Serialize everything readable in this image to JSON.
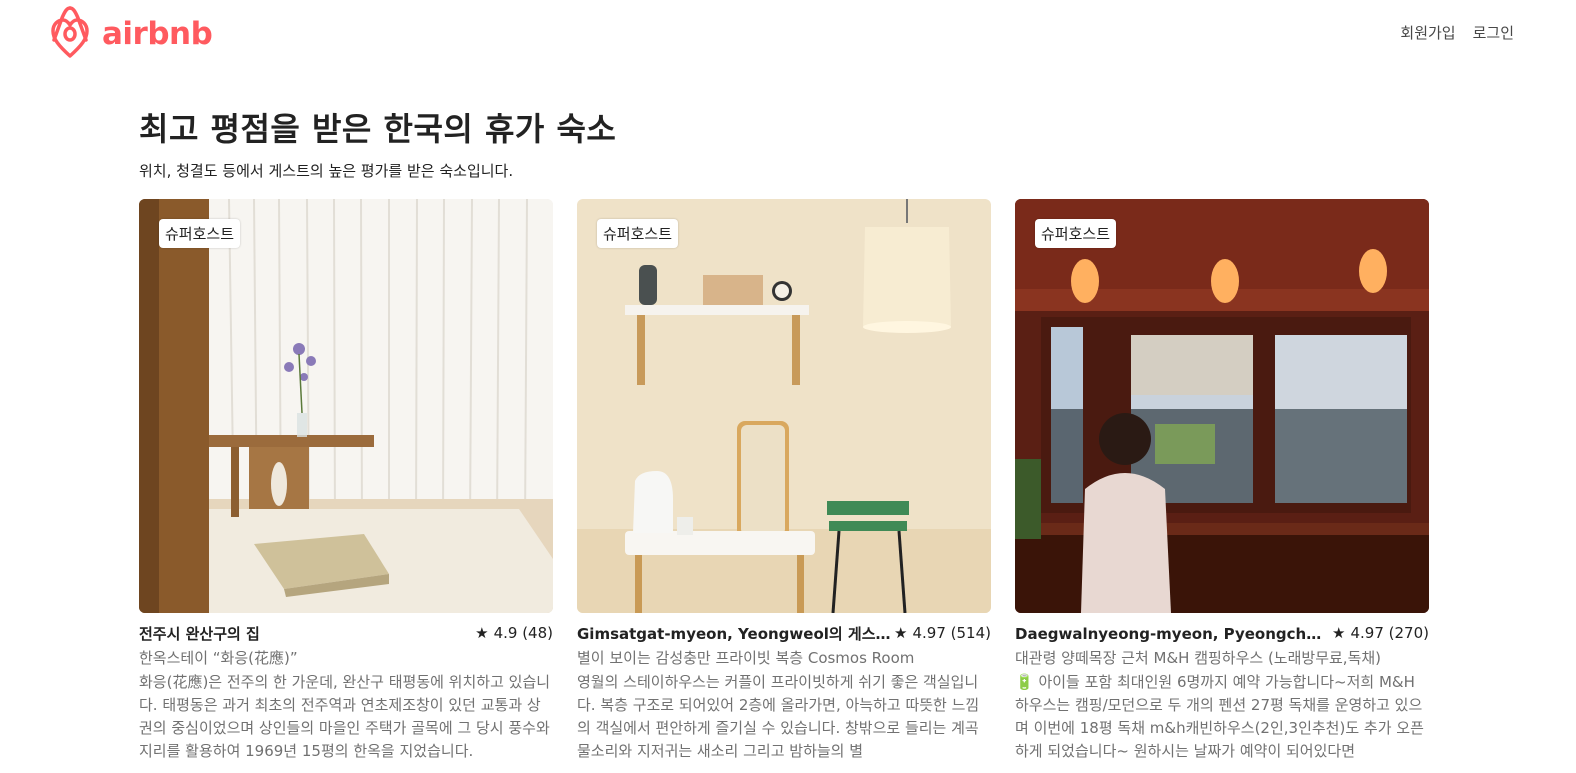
{
  "brand": {
    "name": "airbnb",
    "color": "#ff5a5f",
    "icon": "airbnb-belo-icon"
  },
  "nav": {
    "signup": "회원가입",
    "login": "로그인"
  },
  "section": {
    "title": "최고 평점을 받은 한국의 휴가 숙소",
    "subtitle": "위치, 청결도 등에서 게스트의 높은 평가를 받은 숙소입니다."
  },
  "listings": [
    {
      "badge": "슈퍼호스트",
      "title": "전주시 완산구의 집",
      "rating": "4.9",
      "reviews": "(48)",
      "subtitle": "한옥스테이 “화응(花應)”",
      "description": "화응(花應)은 전주의 한 가운데, 완산구 태평동에 위치하고 있습니다. 태평동은 과거 최초의 전주역과 연초제조창이 있던 교통과 상권의 중심이었으며 상인들의 마을인 주택가 골목에 그 당시 풍수와 지리를 활용하여 1969년 15평의 한옥을 지었습니다."
    },
    {
      "badge": "슈퍼호스트",
      "title": "Gimsatgat-myeon, Yeongweol의 게스트하우스",
      "rating": "4.97",
      "reviews": "(514)",
      "subtitle": "별이 보이는 감성충만 프라이빗 복층 Cosmos Room",
      "description": "영월의 스테이하우스는 커플이 프라이빗하게 쉬기 좋은 객실입니다. 복층 구조로 되어있어 2층에 올라가면, 아늑하고 따뜻한 느낌의 객실에서 편안하게 즐기실 수 있습니다. 창밖으로 들리는 계곡물소리와 지저귀는 새소리 그리고 밤하늘의 별"
    },
    {
      "badge": "슈퍼호스트",
      "title": "Daegwalnyeong-myeon, Pyeongchang-gun의 펜션",
      "rating": "4.97",
      "reviews": "(270)",
      "subtitle": "대관령 양떼목장 근처 M&H 캠핑하우스 (노래방무료,독채)",
      "description": "🔋 아이들 포함 최대인원 6명까지 예약 가능합니다~저희 M&H 하우스는 캠핑/모던으로 두 개의 펜션 27평 독채를 운영하고 있으며 이번에 18평 독채 m&h캐빈하우스(2인,3인추천)도 추가 오픈하게 되었습니다~ 원하시는 날짜가 예약이 되어있다면"
    }
  ],
  "star_glyph": "★"
}
